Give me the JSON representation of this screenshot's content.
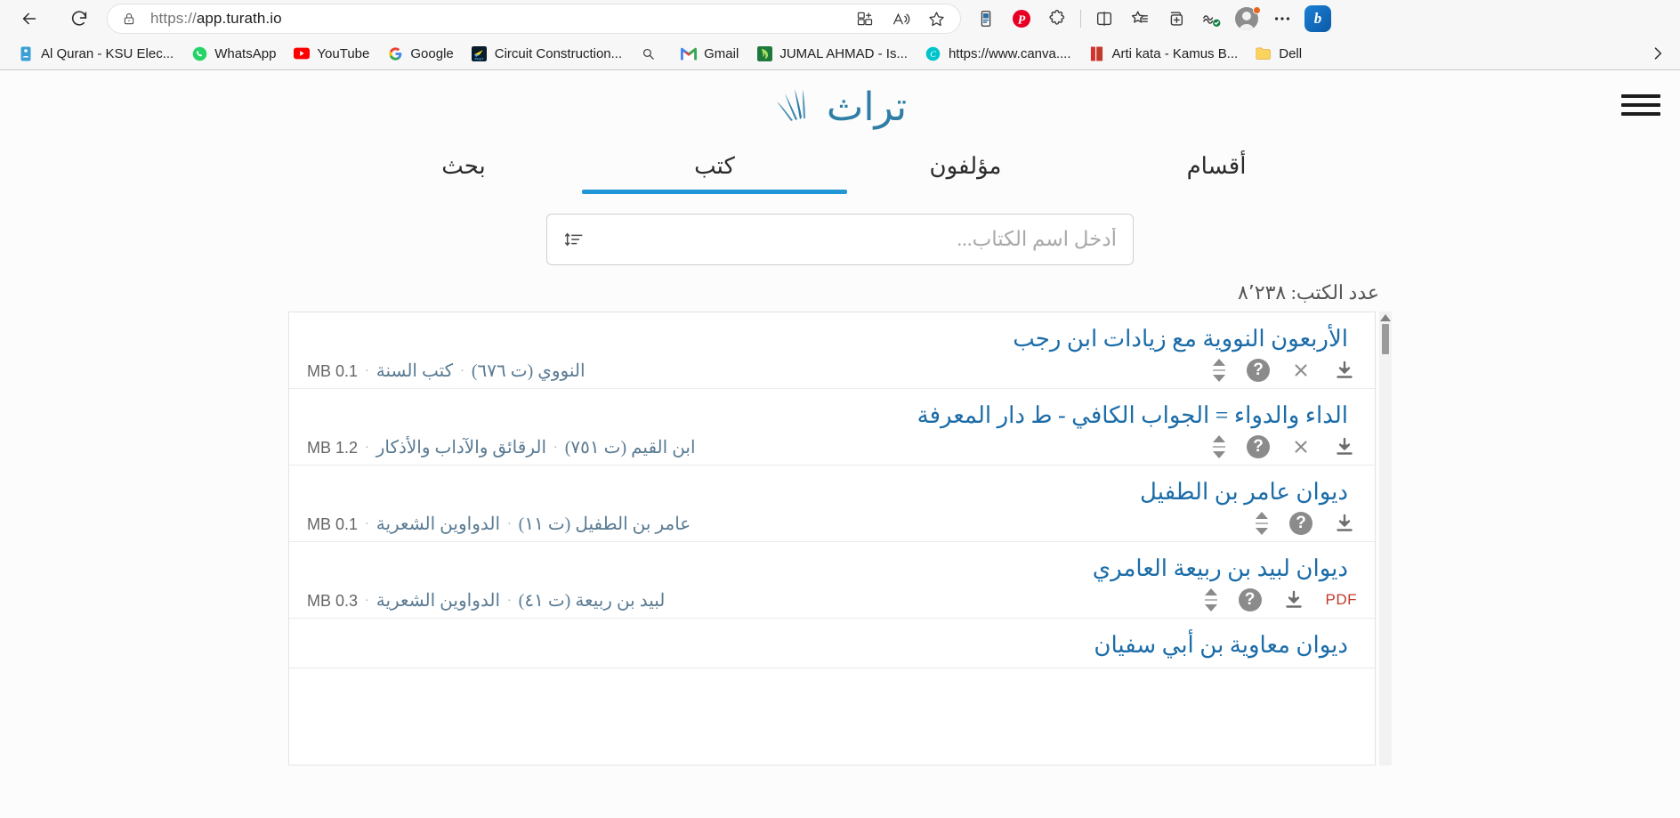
{
  "browser": {
    "back_label": "Back",
    "reload_label": "Refresh",
    "url_scheme": "https://",
    "url_host": "app.turath.io",
    "lock_icon": "lock-icon",
    "toolbar_icons": [
      {
        "name": "split-screen-add-icon",
        "label": "Split screen"
      },
      {
        "name": "read-aloud-icon",
        "label": "Read aloud"
      },
      {
        "name": "favorite-star-icon",
        "label": "Add this page to favorites"
      },
      {
        "name": "device-cast-icon",
        "label": "Device"
      },
      {
        "name": "pinterest-icon",
        "label": "Pinterest"
      },
      {
        "name": "extensions-puzzle-icon",
        "label": "Extensions"
      },
      {
        "name": "split-screen-icon",
        "label": "Split screen"
      },
      {
        "name": "collections-star-icon",
        "label": "Collections"
      },
      {
        "name": "add-tab-group-icon",
        "label": "Tab actions"
      },
      {
        "name": "browser-essentials-icon",
        "label": "Browser essentials"
      },
      {
        "name": "profile-avatar-icon",
        "label": "Profile"
      },
      {
        "name": "settings-more-icon",
        "label": "Settings and more"
      },
      {
        "name": "copilot-icon",
        "label": "Copilot"
      }
    ],
    "bookmarks": [
      {
        "label": "Al Quran - KSU Elec...",
        "icon": "quran-icon",
        "color": "#2e86c1",
        "glyph": "م"
      },
      {
        "label": "WhatsApp",
        "icon": "whatsapp-icon",
        "color": "#25d366",
        "glyph": "✆"
      },
      {
        "label": "YouTube",
        "icon": "youtube-icon",
        "color": "#ff0000",
        "glyph": "▶"
      },
      {
        "label": "Google",
        "icon": "google-icon",
        "color": "#ffffff",
        "glyph": "G"
      },
      {
        "label": "Circuit Construction...",
        "icon": "phet-icon",
        "color": "#0b1d2b",
        "glyph": "◢"
      },
      {
        "label": "",
        "icon": "search-magnifier-icon",
        "color": "#f7f7f7",
        "glyph": "⚲"
      },
      {
        "label": "Gmail",
        "icon": "gmail-icon",
        "color": "#ffffff",
        "glyph": "M"
      },
      {
        "label": "JUMAL AHMAD - Is...",
        "icon": "jumal-icon",
        "color": "#1e6b3a",
        "glyph": "ʃ"
      },
      {
        "label": "https://www.canva....",
        "icon": "canva-icon",
        "color": "#00c4cc",
        "glyph": "C"
      },
      {
        "label": "Arti kata - Kamus B...",
        "icon": "kamus-book-icon",
        "color": "#c0392b",
        "glyph": "▌"
      },
      {
        "label": "Dell",
        "icon": "folder-icon",
        "color": "#f3c042",
        "glyph": "▱"
      }
    ],
    "bookmarks_overflow_icon": "chevron-right-icon"
  },
  "site": {
    "logo_text": "تراث",
    "logo_icon": "fan-leaf-icon",
    "menu_icon": "hamburger-menu-icon",
    "accent_color": "#2196d6",
    "link_color": "#1b6ca8",
    "tabs": [
      {
        "label": "أقسام",
        "name": "tab-sections",
        "active": false
      },
      {
        "label": "مؤلفون",
        "name": "tab-authors",
        "active": false
      },
      {
        "label": "كتب",
        "name": "tab-books",
        "active": true
      },
      {
        "label": "بحث",
        "name": "tab-search",
        "active": false
      }
    ],
    "search": {
      "placeholder": "أدخل اسم الكتاب...",
      "value": "",
      "sort_icon": "sort-lines-icon"
    },
    "count_label": "عدد الكتب: ٨٬٢٣٨",
    "books": [
      {
        "title": "الأربعون النووية مع زيادات ابن رجب",
        "author": "النووي (ت ٦٧٦)",
        "category": "كتب السنة",
        "size": "0.1 MB",
        "has_info": true,
        "has_close": true,
        "has_download": true,
        "pdf_label": ""
      },
      {
        "title": "الداء والدواء = الجواب الكافي - ط دار المعرفة",
        "author": "ابن القيم (ت ٧٥١)",
        "category": "الرقائق والآداب والأذكار",
        "size": "1.2 MB",
        "has_info": true,
        "has_close": true,
        "has_download": true,
        "pdf_label": ""
      },
      {
        "title": "ديوان عامر بن الطفيل",
        "author": "عامر بن الطفيل (ت ١١)",
        "category": "الدواوين الشعرية",
        "size": "0.1 MB",
        "has_info": true,
        "has_close": false,
        "has_download": true,
        "pdf_label": ""
      },
      {
        "title": "ديوان لبيد بن ربيعة العامري",
        "author": "لبيد بن ربيعة (ت ٤١)",
        "category": "الدواوين الشعرية",
        "size": "0.3 MB",
        "has_info": true,
        "has_close": false,
        "has_download": true,
        "pdf_label": "PDF"
      },
      {
        "title": "ديوان معاوية بن أبي سفيان",
        "author": "",
        "category": "",
        "size": "",
        "has_info": false,
        "has_close": false,
        "has_download": false,
        "pdf_label": ""
      }
    ]
  }
}
